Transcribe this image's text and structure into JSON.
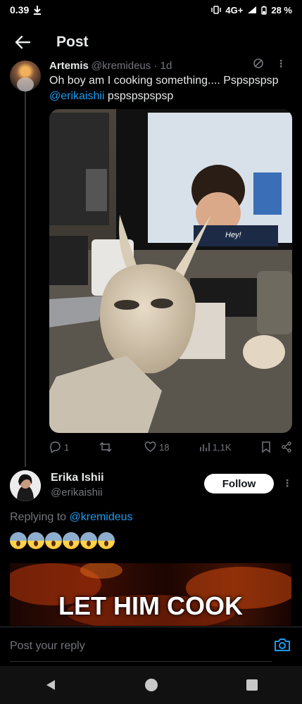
{
  "status_bar": {
    "time": "0.39",
    "network": "4G+",
    "battery": "28 %"
  },
  "header": {
    "title": "Post"
  },
  "parent_post": {
    "name": "Artemis",
    "meta": "@kremideus · 1d",
    "text": "Oh boy am I cooking something.... Pspspspsp",
    "mention": "@erikaishii",
    "text_after": " pspspspspsp",
    "image_caption": "Hey!",
    "stats": {
      "replies": "1",
      "reposts": "",
      "likes": "18",
      "views": "1,1K"
    }
  },
  "reply_post": {
    "name": "Erika Ishii",
    "handle": "@erikaishii",
    "follow_label": "Follow",
    "replying_prefix": "Replying to ",
    "replying_mention": "@kremideus",
    "emoji_count": 6,
    "gif_text": "LET HIM COOK"
  },
  "composer": {
    "placeholder": "Post your reply"
  },
  "colors": {
    "accent": "#1d9bf0",
    "background": "#000000",
    "muted": "#71767b"
  }
}
